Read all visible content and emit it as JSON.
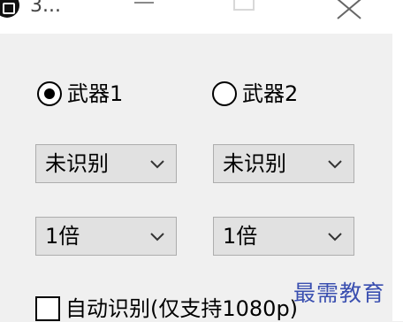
{
  "window": {
    "title": "3...",
    "icon": "app-icon"
  },
  "weapons": {
    "options": [
      {
        "label": "武器1",
        "checked": true
      },
      {
        "label": "武器2",
        "checked": false
      }
    ]
  },
  "status_selects": [
    {
      "value": "未识别"
    },
    {
      "value": "未识别"
    }
  ],
  "magnification_selects": [
    {
      "value": "1倍"
    },
    {
      "value": "1倍"
    }
  ],
  "auto_detect": {
    "label": "自动识别(仅支持1080p)",
    "checked": false
  },
  "watermark": "最需教育",
  "colors": {
    "window_bg": "#f0f0f0",
    "select_bg": "#e1e1e1",
    "watermark": "#3a4fb0"
  }
}
